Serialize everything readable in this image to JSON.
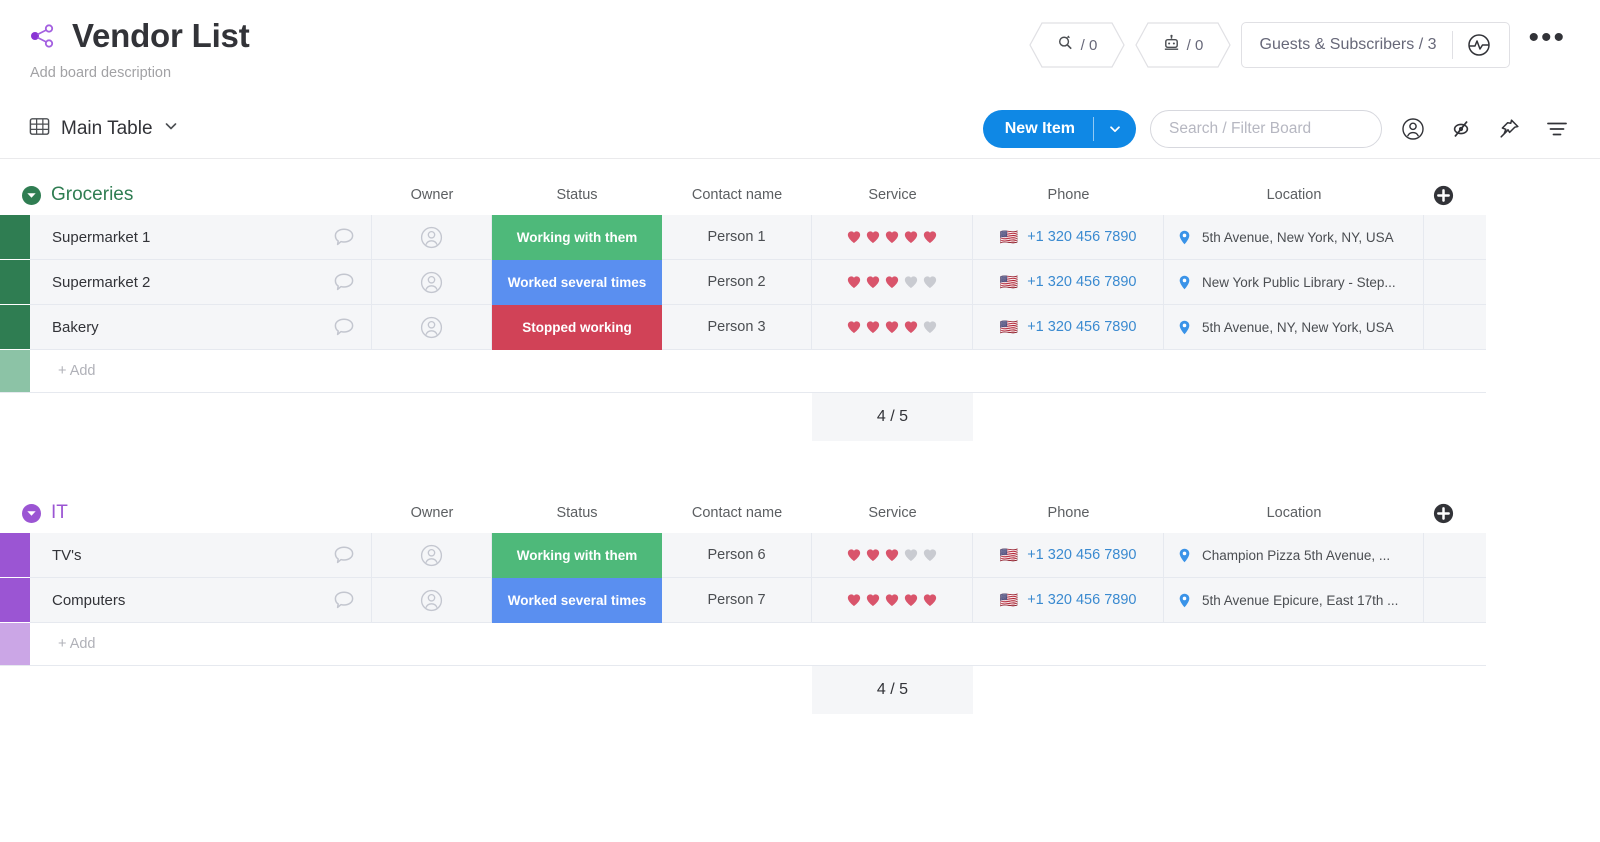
{
  "header": {
    "title": "Vendor List",
    "description": "Add board description",
    "share_icon": "share-icon",
    "badges": [
      {
        "icon": "integrations-icon",
        "label": "/ 0"
      },
      {
        "icon": "automations-robot-icon",
        "label": "/ 0"
      }
    ],
    "guests_label": "Guests & Subscribers / 3",
    "activity_icon": "activity-log-icon",
    "kebab_label": "•••"
  },
  "toolbar": {
    "view_icon": "table-view-icon",
    "view_label": "Main Table",
    "view_chevron": "chevron-down-icon",
    "new_item_label": "New Item",
    "new_item_chevron": "chevron-down-icon",
    "search_placeholder": "Search / Filter Board",
    "icons": [
      "person-icon",
      "hide-eye-icon",
      "pin-icon",
      "filter-icon"
    ]
  },
  "columns": [
    "Owner",
    "Status",
    "Contact name",
    "Service",
    "Phone",
    "Location"
  ],
  "colors": {
    "status_green": "#4eb97a",
    "status_blue": "#5a8ff0",
    "status_red": "#d14257",
    "group_green": "#2f7d52",
    "group_purple": "#9b55d3",
    "accent_blue": "#0f88e5",
    "heart_filled": "#d9546b",
    "heart_empty": "#c9cbd1",
    "link_blue": "#3a8ad0"
  },
  "groups": [
    {
      "name": "Groceries",
      "color": "#2f7d52",
      "bar_color": "#2f7d52",
      "add_bar_color": "#8cc3a6",
      "collapse_icon": "collapse-arrow-icon",
      "add_label": "+ Add",
      "plus_icon": "add-column-icon",
      "summary": "4 / 5",
      "items": [
        {
          "name": "Supermarket 1",
          "comment_icon": "comment-bubble-icon",
          "owner_icon": "person-placeholder-icon",
          "status": "Working with them",
          "status_color": "#4eb97a",
          "contact": "Person 1",
          "service_filled": 5,
          "service_total": 5,
          "flag": "🇺🇸",
          "phone": "+1 320 456 7890",
          "location_icon": "location-pin-icon",
          "location": "5th Avenue, New York, NY, USA"
        },
        {
          "name": "Supermarket 2",
          "comment_icon": "comment-bubble-icon",
          "owner_icon": "person-placeholder-icon",
          "status": "Worked several times",
          "status_color": "#5a8ff0",
          "contact": "Person 2",
          "service_filled": 3,
          "service_total": 5,
          "flag": "🇺🇸",
          "phone": "+1 320 456 7890",
          "location_icon": "location-pin-icon",
          "location": "New York Public Library - Step..."
        },
        {
          "name": "Bakery",
          "comment_icon": "comment-bubble-icon",
          "owner_icon": "person-placeholder-icon",
          "status": "Stopped working",
          "status_color": "#d14257",
          "contact": "Person 3",
          "service_filled": 4,
          "service_total": 5,
          "flag": "🇺🇸",
          "phone": "+1 320 456 7890",
          "location_icon": "location-pin-icon",
          "location": "5th Avenue, NY, New York, USA"
        }
      ]
    },
    {
      "name": "IT",
      "color": "#9b55d3",
      "bar_color": "#9b55d3",
      "add_bar_color": "#cba6e6",
      "collapse_icon": "collapse-arrow-icon",
      "add_label": "+ Add",
      "plus_icon": "add-column-icon",
      "summary": "4 / 5",
      "items": [
        {
          "name": "TV's",
          "comment_icon": "comment-bubble-icon",
          "owner_icon": "person-placeholder-icon",
          "status": "Working with them",
          "status_color": "#4eb97a",
          "contact": "Person 6",
          "service_filled": 3,
          "service_total": 5,
          "flag": "🇺🇸",
          "phone": "+1 320 456 7890",
          "location_icon": "location-pin-icon",
          "location": "Champion Pizza 5th Avenue, ..."
        },
        {
          "name": "Computers",
          "comment_icon": "comment-bubble-icon",
          "owner_icon": "person-placeholder-icon",
          "status": "Worked several times",
          "status_color": "#5a8ff0",
          "contact": "Person 7",
          "service_filled": 5,
          "service_total": 5,
          "flag": "🇺🇸",
          "phone": "+1 320 456 7890",
          "location_icon": "location-pin-icon",
          "location": "5th Avenue Epicure, East 17th ..."
        }
      ]
    }
  ]
}
